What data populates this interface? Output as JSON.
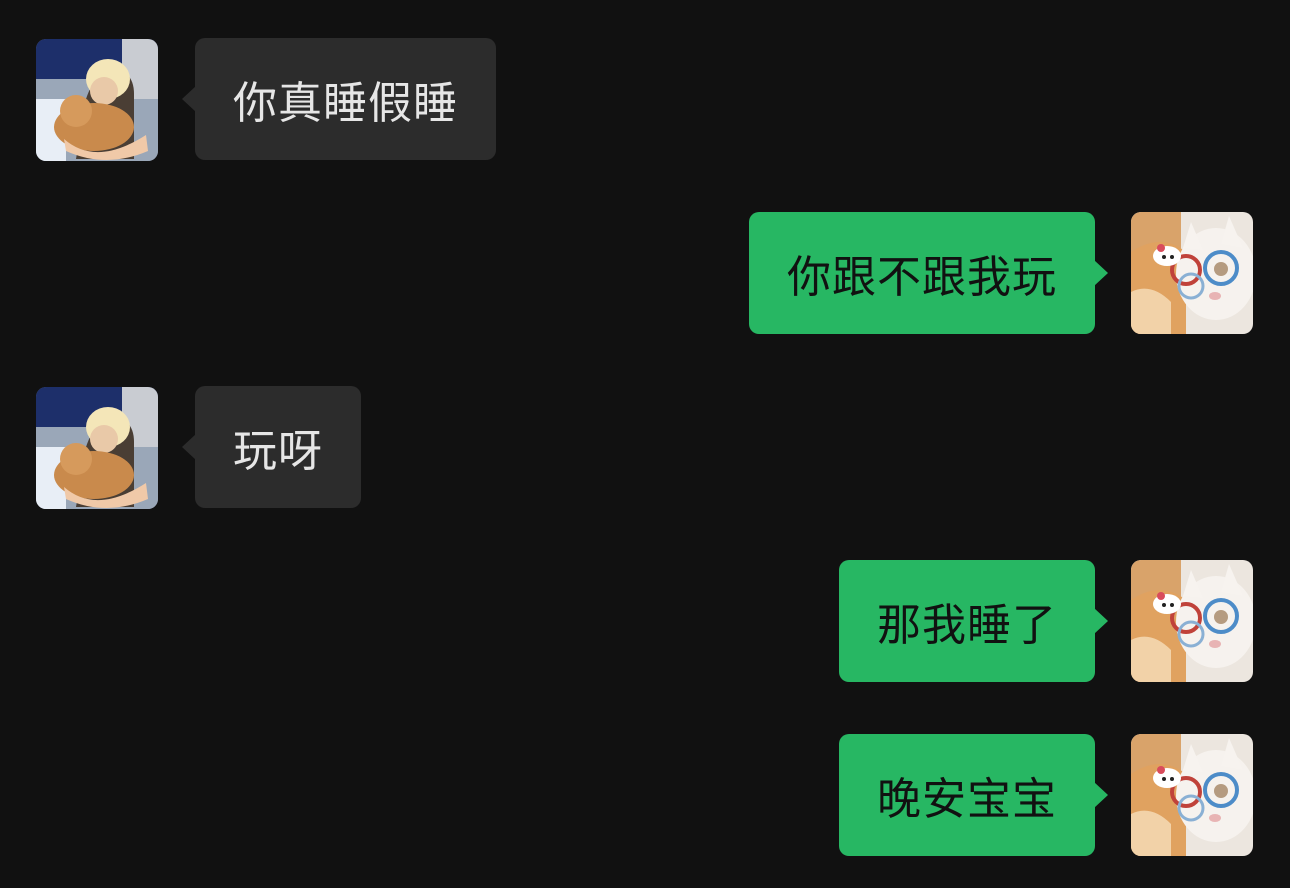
{
  "chat": {
    "messages": [
      {
        "sender": "contact",
        "text": "你真睡假睡",
        "avatar": "contact-avatar"
      },
      {
        "sender": "me",
        "text": "你跟不跟我玩",
        "avatar": "my-avatar"
      },
      {
        "sender": "contact",
        "text": "玩呀",
        "avatar": "contact-avatar"
      },
      {
        "sender": "me",
        "text": "那我睡了",
        "avatar": "my-avatar"
      },
      {
        "sender": "me",
        "text": "晚安宝宝",
        "avatar": "my-avatar"
      }
    ]
  },
  "colors": {
    "background": "#111111",
    "incoming_bubble": "#2c2c2c",
    "outgoing_bubble": "#27b763"
  }
}
